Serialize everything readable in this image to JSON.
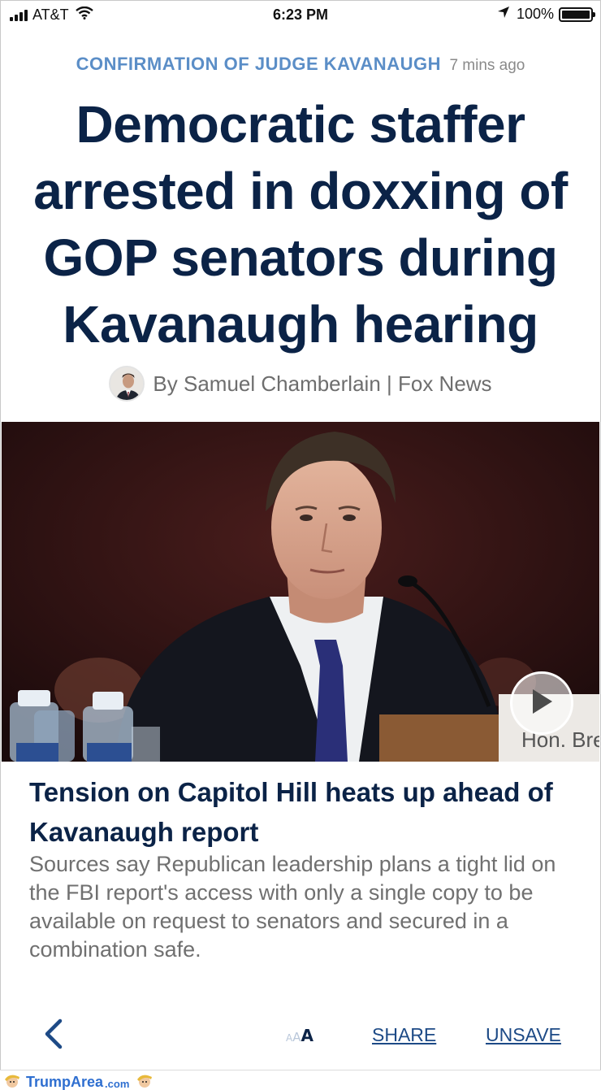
{
  "status_bar": {
    "carrier": "AT&T",
    "time": "6:23 PM",
    "battery": "100%"
  },
  "article": {
    "category": "CONFIRMATION OF JUDGE KAVANAUGH",
    "time_ago": "7 mins ago",
    "headline": "Democratic staffer arrested in doxxing of GOP senators during Kavanaugh hearing",
    "byline": "By Samuel Chamberlain | Fox News"
  },
  "media": {
    "nameplate": "Hon. Bret"
  },
  "related_story": {
    "title": "Tension on Capitol Hill heats up ahead of Kavanaugh report",
    "summary": "Sources say Republican leadership plans a tight lid on the FBI report's access with only a single copy to be available on request to senators and secured in a combination safe."
  },
  "toolbar": {
    "text_size_label": "AAA",
    "share_label": "SHARE",
    "unsave_label": "UNSAVE"
  },
  "footer": {
    "brand": "TrumpArea",
    "brand_suffix": ".com"
  },
  "colors": {
    "headline": "#0b2347",
    "kicker": "#5b8ec7",
    "link": "#1d4a86"
  }
}
